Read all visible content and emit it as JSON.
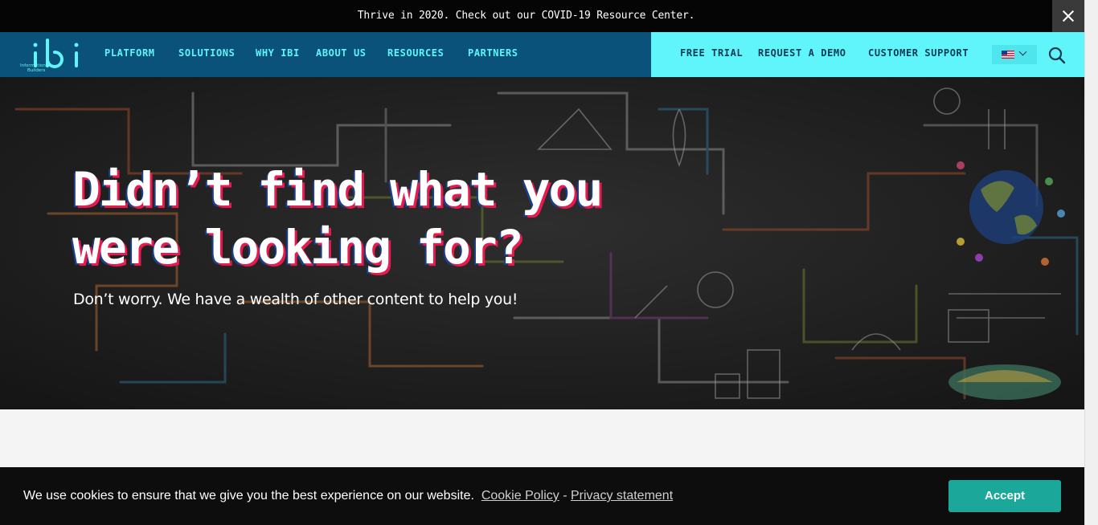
{
  "announcement": {
    "text": "Thrive in 2020. Check out our COVID-19 Resource Center.",
    "close_icon": "close-icon"
  },
  "header": {
    "logo_letters": "ibi",
    "logo_text": "Information Builders",
    "primary_nav": [
      "PLATFORM",
      "SOLUTIONS",
      "WHY IBI",
      "ABOUT US",
      "RESOURCES",
      "PARTNERS"
    ],
    "secondary_nav": [
      "FREE TRIAL",
      "REQUEST A DEMO",
      "CUSTOMER SUPPORT"
    ],
    "language_icon": "us-flag-icon",
    "search_icon": "search-icon",
    "colors": {
      "primary_bg": "#0a5279",
      "secondary_bg": "#5ff5fb"
    }
  },
  "hero": {
    "title_line1": "Didn’t find what you",
    "title_line2": "were looking for?",
    "subtitle": "Don’t worry. We have a wealth of other content to help you!"
  },
  "cookie_bar": {
    "message": "We use cookies to ensure that we give you the best experience on our website.",
    "cookie_policy_link": "Cookie Policy",
    "separator": "-",
    "privacy_link": "Privacy statement",
    "accept_label": "Accept",
    "accent_color": "#1ba89a"
  }
}
